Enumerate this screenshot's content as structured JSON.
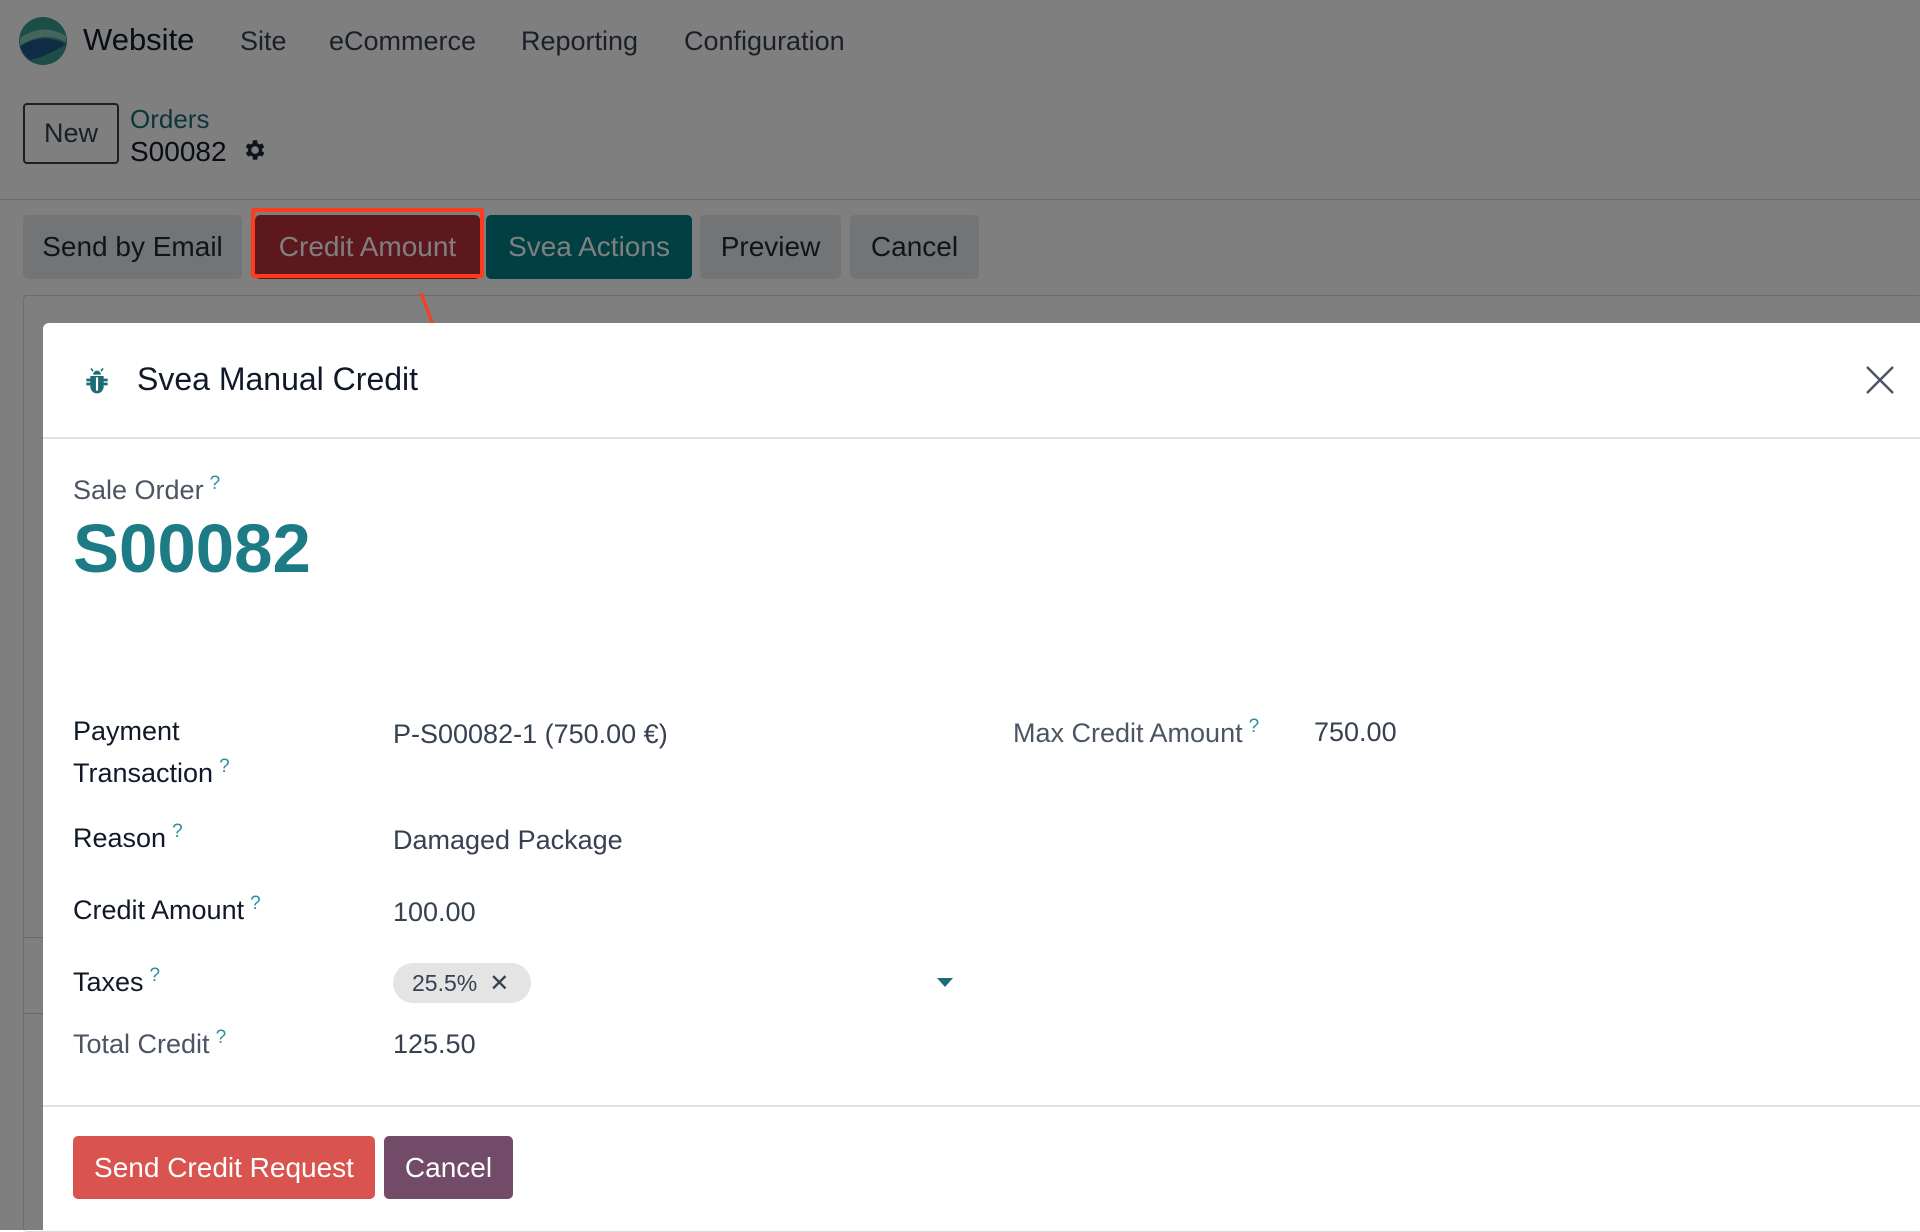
{
  "navbar": {
    "app_name": "Website",
    "menu": [
      "Site",
      "eCommerce",
      "Reporting",
      "Configuration"
    ]
  },
  "control_panel": {
    "new_button": "New",
    "breadcrumb_parent": "Orders",
    "breadcrumb_current": "S00082",
    "status_buttons": [
      "Send by Email",
      "Credit Amount",
      "Svea Actions",
      "Preview",
      "Cancel"
    ]
  },
  "dialog": {
    "icon": "bug-icon",
    "title": "Svea Manual Credit",
    "sale_order_label": "Sale Order",
    "sale_order_value": "S00082",
    "help_mark": "?",
    "fields": {
      "payment_transaction": {
        "label_line1": "Payment",
        "label_line2": "Transaction",
        "value": "P-S00082-1 (750.00 €)"
      },
      "max_credit_amount": {
        "label": "Max Credit Amount",
        "value": "750.00"
      },
      "reason": {
        "label": "Reason",
        "value": "Damaged Package"
      },
      "credit_amount": {
        "label": "Credit Amount",
        "value": "100.00"
      },
      "taxes": {
        "label": "Taxes",
        "tags": [
          "25.5%"
        ]
      },
      "total_credit": {
        "label": "Total Credit",
        "value": "125.50"
      }
    },
    "footer": {
      "send_button": "Send Credit Request",
      "cancel_button": "Cancel"
    }
  },
  "colors": {
    "primary_teal": "#017e84",
    "danger": "#d9534f",
    "secondary_purple": "#714b67",
    "highlight": "#ff3b1f"
  }
}
